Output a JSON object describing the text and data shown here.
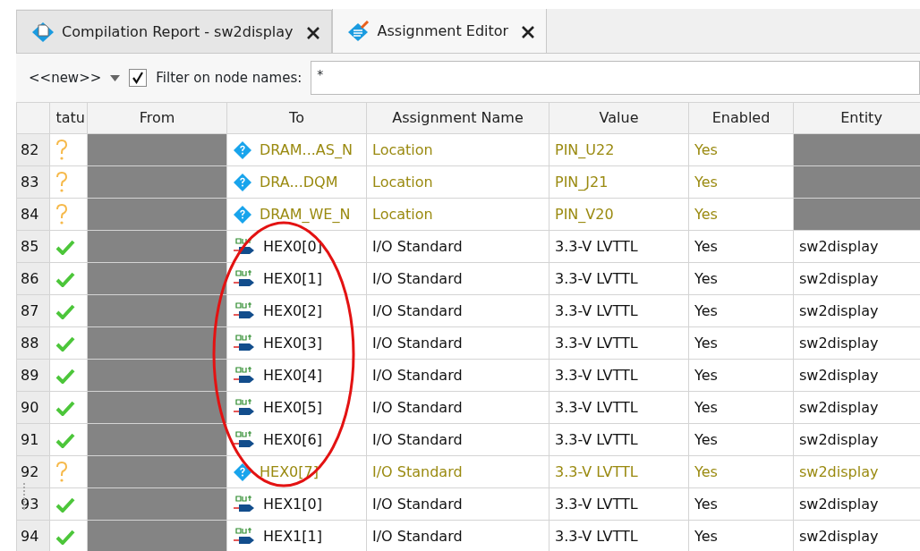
{
  "tabs": [
    {
      "label": "Compilation Report - sw2display",
      "selected": false
    },
    {
      "label": "Assignment Editor",
      "selected": true
    }
  ],
  "toolbar": {
    "preset": "<<new>>",
    "filter_label": "Filter on node names:",
    "filter_checked": true,
    "filter_value": "*"
  },
  "table": {
    "columns": [
      "tatu",
      "From",
      "To",
      "Assignment Name",
      "Value",
      "Enabled",
      "Entity"
    ],
    "rows": [
      {
        "number": "82",
        "status": {
          "kind": "unknown"
        },
        "to": {
          "kind": "unknown",
          "text": "DRAM...AS_N"
        },
        "assignment": "Location",
        "value": "PIN_U22",
        "enabled": "Yes"
      },
      {
        "number": "83",
        "status": {
          "kind": "unknown"
        },
        "to": {
          "kind": "unknown",
          "text": "DRA...DQM"
        },
        "assignment": "Location",
        "value": "PIN_J21",
        "enabled": "Yes"
      },
      {
        "number": "84",
        "status": {
          "kind": "unknown"
        },
        "to": {
          "kind": "unknown",
          "text": "DRAM_WE_N"
        },
        "assignment": "Location",
        "value": "PIN_V20",
        "enabled": "Yes"
      },
      {
        "number": "85",
        "status": {
          "kind": "ok"
        },
        "to": {
          "kind": "output",
          "text": "HEX0[0]"
        },
        "assignment": "I/O Standard",
        "value": "3.3-V LVTTL",
        "enabled": "Yes",
        "entity": "sw2display"
      },
      {
        "number": "86",
        "status": {
          "kind": "ok"
        },
        "to": {
          "kind": "output",
          "text": "HEX0[1]"
        },
        "assignment": "I/O Standard",
        "value": "3.3-V LVTTL",
        "enabled": "Yes",
        "entity": "sw2display"
      },
      {
        "number": "87",
        "status": {
          "kind": "ok"
        },
        "to": {
          "kind": "output",
          "text": "HEX0[2]"
        },
        "assignment": "I/O Standard",
        "value": "3.3-V LVTTL",
        "enabled": "Yes",
        "entity": "sw2display"
      },
      {
        "number": "88",
        "status": {
          "kind": "ok"
        },
        "to": {
          "kind": "output",
          "text": "HEX0[3]"
        },
        "assignment": "I/O Standard",
        "value": "3.3-V LVTTL",
        "enabled": "Yes",
        "entity": "sw2display"
      },
      {
        "number": "89",
        "status": {
          "kind": "ok"
        },
        "to": {
          "kind": "output",
          "text": "HEX0[4]"
        },
        "assignment": "I/O Standard",
        "value": "3.3-V LVTTL",
        "enabled": "Yes",
        "entity": "sw2display"
      },
      {
        "number": "90",
        "status": {
          "kind": "ok"
        },
        "to": {
          "kind": "output",
          "text": "HEX0[5]"
        },
        "assignment": "I/O Standard",
        "value": "3.3-V LVTTL",
        "enabled": "Yes",
        "entity": "sw2display"
      },
      {
        "number": "91",
        "status": {
          "kind": "ok"
        },
        "to": {
          "kind": "output",
          "text": "HEX0[6]"
        },
        "assignment": "I/O Standard",
        "value": "3.3-V LVTTL",
        "enabled": "Yes",
        "entity": "sw2display"
      },
      {
        "number": "92",
        "status": {
          "kind": "unknown"
        },
        "to": {
          "kind": "unknown",
          "text": "HEX0[7]"
        },
        "assignment": "I/O Standard",
        "value": "3.3-V LVTTL",
        "enabled": "Yes",
        "entity": "sw2display"
      },
      {
        "number": "93",
        "status": {
          "kind": "ok"
        },
        "to": {
          "kind": "output",
          "text": "HEX1[0]"
        },
        "assignment": "I/O Standard",
        "value": "3.3-V LVTTL",
        "enabled": "Yes",
        "entity": "sw2display"
      },
      {
        "number": "94",
        "status": {
          "kind": "ok"
        },
        "to": {
          "kind": "output",
          "text": "HEX1[1]"
        },
        "assignment": "I/O Standard",
        "value": "3.3-V LVTTL",
        "enabled": "Yes",
        "entity": "sw2display"
      }
    ]
  },
  "annotation": {
    "kind": "ellipse"
  }
}
